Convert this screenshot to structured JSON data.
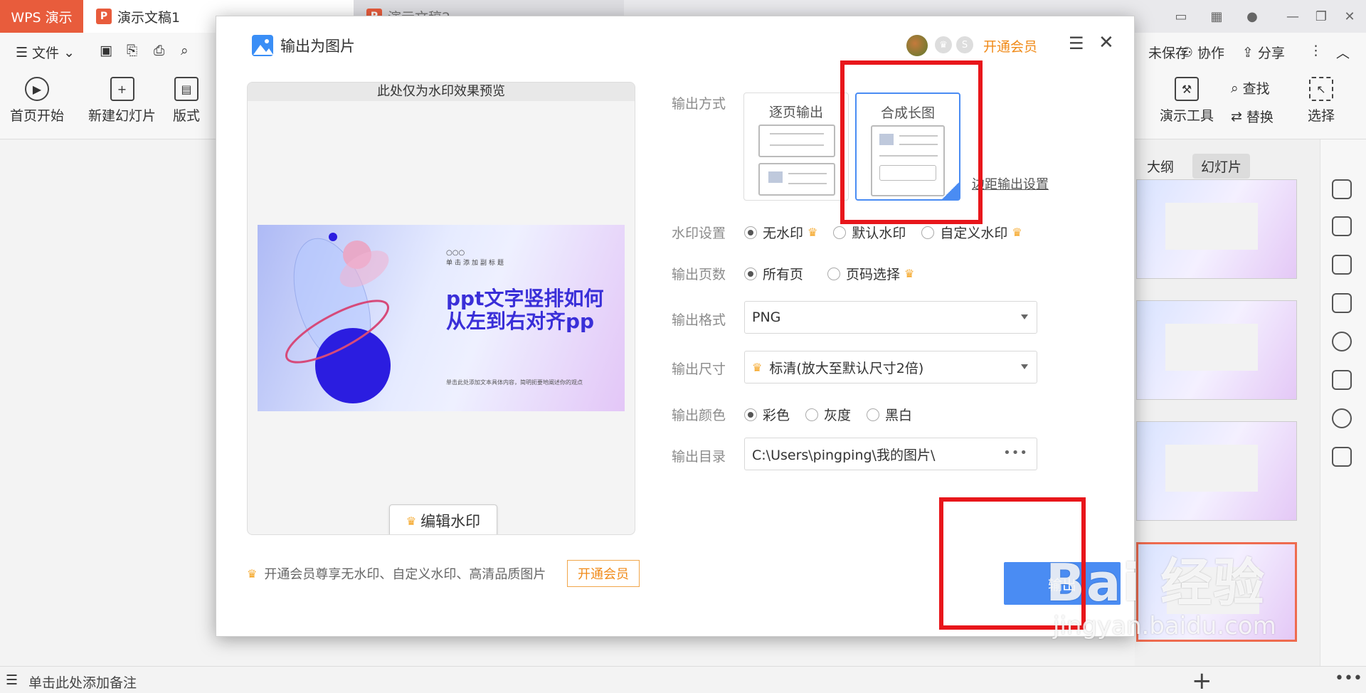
{
  "titlebar": {
    "wps_tab": "WPS 演示",
    "doc_tabs": [
      "演示文稿1",
      "演示文稿2"
    ]
  },
  "menubar": {
    "file_label": "文件",
    "save_label": "未保存",
    "collab_label": "协作",
    "share_label": "分享"
  },
  "ribbon": {
    "play_label": "首页开始",
    "new_slide_label": "新建幻灯片",
    "layout_label": "版式",
    "present_tools_label": "演示工具",
    "find_label": "查找",
    "replace_label": "替换",
    "select_label": "选择"
  },
  "right_panel": {
    "tabs": [
      "大纲",
      "幻灯片"
    ],
    "active_tab": "幻灯片"
  },
  "statusbar": {
    "note_placeholder": "单击此处添加备注"
  },
  "dialog": {
    "title": "输出为图片",
    "open_vip_label": "开通会员",
    "preview_header": "此处仅为水印效果预览",
    "slide": {
      "dots": "○○○",
      "subtitle": "单击添加副标题",
      "title": "ppt文字竖排如何从左到右对齐pp",
      "body": "单击此处添加文本具体内容，简明扼要地阐述你的观点"
    },
    "edit_watermark_label": "编辑水印",
    "promo_text": "开通会员尊享无水印、自定义水印、高清品质图片",
    "promo_button": "开通会员",
    "output_mode": {
      "label": "输出方式",
      "options": [
        "逐页输出",
        "合成长图"
      ],
      "selected": "合成长图",
      "margin_link": "边距输出设置"
    },
    "watermark": {
      "label": "水印设置",
      "options": [
        "无水印",
        "默认水印",
        "自定义水印"
      ],
      "selected": "无水印"
    },
    "pages": {
      "label": "输出页数",
      "options": [
        "所有页",
        "页码选择"
      ],
      "selected": "所有页"
    },
    "format": {
      "label": "输出格式",
      "value": "PNG"
    },
    "size": {
      "label": "输出尺寸",
      "value": "标清(放大至默认尺寸2倍)"
    },
    "color": {
      "label": "输出颜色",
      "options": [
        "彩色",
        "灰度",
        "黑白"
      ],
      "selected": "彩色"
    },
    "directory": {
      "label": "输出目录",
      "value": "C:\\Users\\pingping\\我的图片\\"
    },
    "export_label": "输出"
  },
  "watermark_overlay": {
    "brand": "Bai 经验",
    "url": "jingyan.baidu.com"
  },
  "colors": {
    "accent_blue": "#4a8cf3",
    "vip_orange": "#f08a18",
    "highlight_red": "#e8161b",
    "wps_red": "#e85c3c"
  }
}
